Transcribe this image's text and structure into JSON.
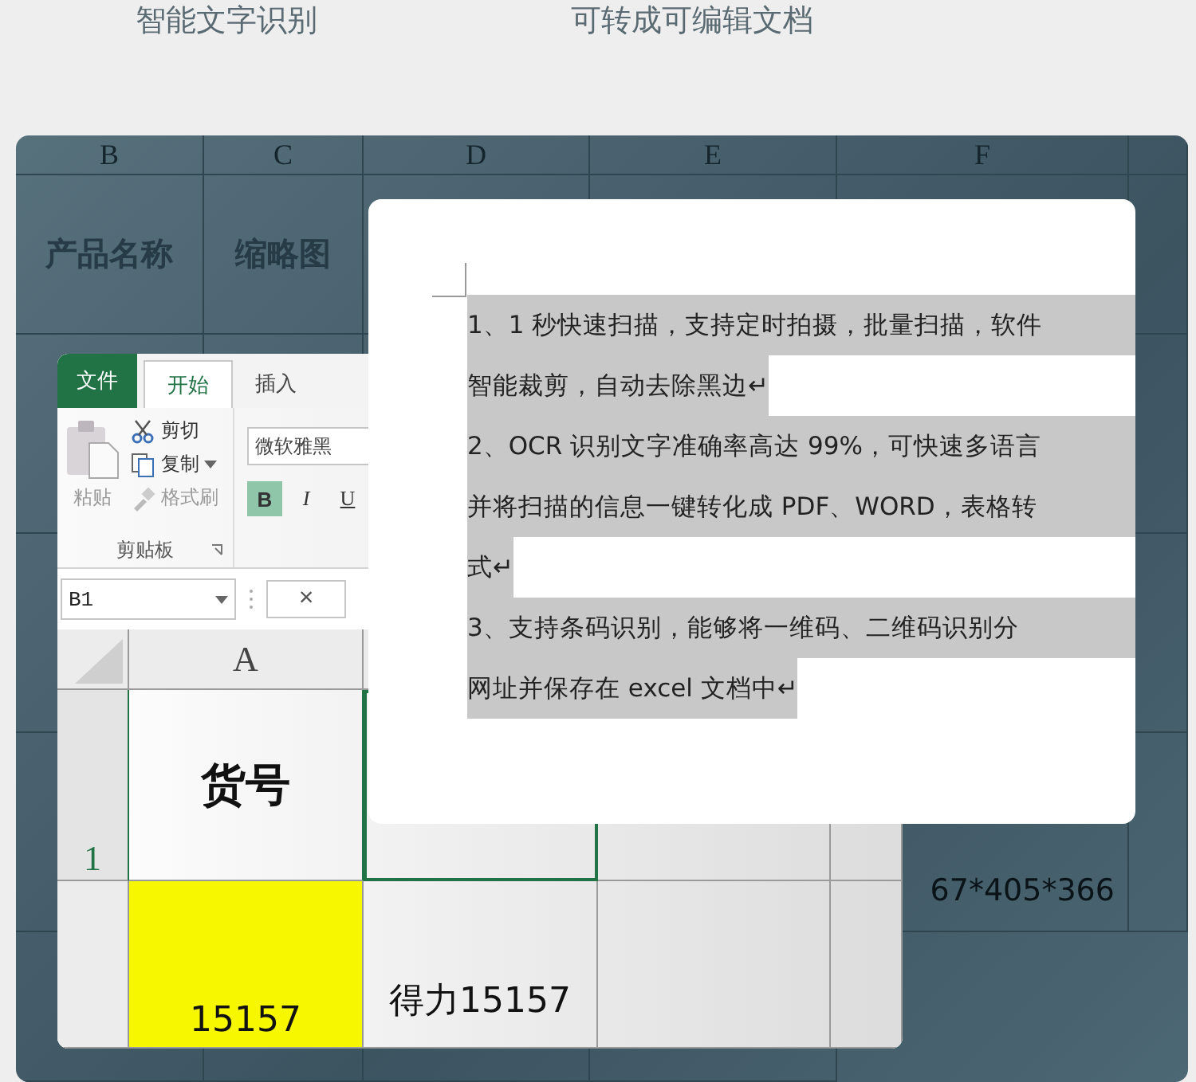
{
  "captions": [
    "智能文字识别",
    "可转成可编辑文档"
  ],
  "background_sheet": {
    "columns": [
      "B",
      "C",
      "D",
      "E",
      "F"
    ],
    "header_cells": [
      "产品名称",
      "缩略图"
    ],
    "size_text": "67*405*366"
  },
  "excel": {
    "tabs": [
      {
        "label": "文件",
        "kind": "file",
        "selected": false
      },
      {
        "label": "开始",
        "kind": "tab",
        "selected": true
      },
      {
        "label": "插入",
        "kind": "tab",
        "selected": false
      }
    ],
    "clipboard": {
      "paste": "粘贴",
      "cut": "剪切",
      "copy": "复制",
      "format_painter": "格式刷",
      "group": "剪贴板"
    },
    "font": {
      "name": "微软雅黑",
      "styles": [
        {
          "label": "B",
          "selected": true
        },
        {
          "label": "I",
          "selected": false
        },
        {
          "label": "U",
          "selected": false
        }
      ]
    },
    "name_box": "B1",
    "cancel": "×",
    "column_header": "A",
    "row_header": "1",
    "cells": {
      "a1": "货号",
      "a2": "15157",
      "b2": "得力15157"
    }
  },
  "document": {
    "lines": [
      {
        "text": "1、1 秒快速扫描，支持定时拍摄，批量扫描，软件",
        "wraps": true
      },
      {
        "text": "智能裁剪，自动去除黑边↵",
        "wraps": false
      },
      {
        "text": "2、OCR 识别文字准确率高达 99%，可快速多语言",
        "wraps": true
      },
      {
        "text": "并将扫描的信息一键转化成 PDF、WORD，表格转",
        "wraps": true
      },
      {
        "text": "式↵",
        "wraps": false
      },
      {
        "text": "3、支持条码识别，能够将一维码、二维码识别分",
        "wraps": true
      },
      {
        "text": "网址并保存在 excel 文档中↵",
        "wraps": false
      }
    ]
  }
}
